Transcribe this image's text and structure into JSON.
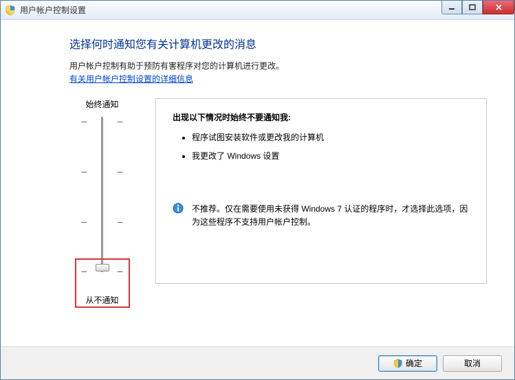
{
  "window": {
    "title": "用户帐户控制设置"
  },
  "heading": "选择何时通知您有关计算机更改的消息",
  "description": "用户帐户控制有助于预防有害程序对您的计算机进行更改。",
  "link": "有关用户帐户控制设置的详细信息",
  "slider": {
    "top_label": "始终通知",
    "bottom_label": "从不通知"
  },
  "infobox": {
    "header": "出现以下情况时始终不要通知我:",
    "items": [
      "程序试图安装软件或更改我的计算机",
      "我更改了 Windows 设置"
    ],
    "recommendation": "不推荐。仅在需要使用未获得 Windows 7 认证的程序时，才选择此选项，因为这些程序不支持用户帐户控制。"
  },
  "buttons": {
    "ok": "确定",
    "cancel": "取消"
  }
}
